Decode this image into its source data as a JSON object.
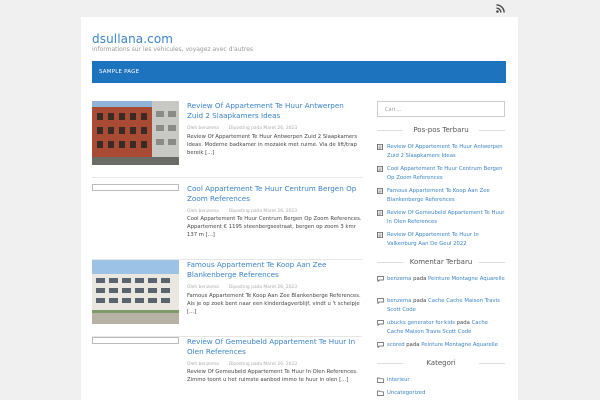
{
  "site": {
    "title": "dsullana.com",
    "description": "informations sur les vehicules, voyagez avec d'autres"
  },
  "nav": {
    "items": [
      {
        "label": "SAMPLE PAGE"
      }
    ]
  },
  "icons": {
    "rss": "rss-icon",
    "post": "document-icon",
    "comment": "comment-icon",
    "folder": "folder-icon"
  },
  "colors": {
    "accent": "#1e73be",
    "link": "#3a83c8"
  },
  "posts": [
    {
      "title": "Review Of Appartement Te Huur Antwerpen Zuid 2 Slaapkamers Ideas",
      "author": "Oleh benzema",
      "date": "Diposting pada Maret 26, 2023",
      "excerpt": "Review Of Appartement Te Huur Antwerpen Zuid 2 Slaapkamers Ideas. Moderne badkamer in mozaiek met ruime. Via de lift/trap bereik [...]"
    },
    {
      "title": "Cool Appartement Te Huur Centrum Bergen Op Zoom References",
      "author": "Oleh benzema",
      "date": "Diposting pada Maret 26, 2023",
      "excerpt": "Cool Appartement Te Huur Centrum Bergen Op Zoom References. Appartement € 1195 steenbergsestraat, bergen op zoom 3 kmr 137 m [...]"
    },
    {
      "title": "Famous Appartement Te Koop Aan Zee Blankenberge References",
      "author": "Oleh benzema",
      "date": "Diposting pada Maret 26, 2023",
      "excerpt": "Famous Appartement Te Koop Aan Zee Blankenberge References. Als je op zoek bent naar een kinderdagverblijf, vindt u 't schelpje [...]"
    },
    {
      "title": "Review Of Gemeubeld Appartement Te Huur In Olen References",
      "author": "Oleh benzema",
      "date": "Diposting pada Maret 26, 2023",
      "excerpt": "Review Of Gemeubeld Appartement Te Huur In Olen References. Zimmo toont u het ruimste aanbod immo te huur in olen [...]"
    }
  ],
  "sidebar": {
    "search_placeholder": "Cari ...",
    "recent_posts_title": "Pos-pos Terbaru",
    "recent_posts": [
      "Review Of Appartement Te Huur Antwerpen Zuid 2 Slaapkamers Ideas",
      "Cool Appartement Te Huur Centrum Bergen Op Zoom References",
      "Famous Appartement Te Koop Aan Zee Blankenberge References",
      "Review Of Gemeubeld Appartement Te Huur In Olen References",
      "Review Of Appartement Te Huur In Valkenburg Aan De Geul 2022"
    ],
    "recent_comments_title": "Komentar Terbaru",
    "recent_comments": [
      {
        "author": "benzema",
        "sep": " pada ",
        "post": "Peinture Montagne Aquarelle"
      },
      {
        "author": "benzema",
        "sep": " pada ",
        "post": "Cache Cache Maison Travis Scott Code"
      },
      {
        "author": "ubucks generator for kids",
        "sep": " pada ",
        "post": "Cache Cache Maison Travis Scott Code"
      },
      {
        "author": "scored",
        "sep": " pada ",
        "post": "Peinture Montagne Aquarelle"
      }
    ],
    "categories_title": "Kategori",
    "categories": [
      "interieur",
      "Uncategorized"
    ]
  }
}
